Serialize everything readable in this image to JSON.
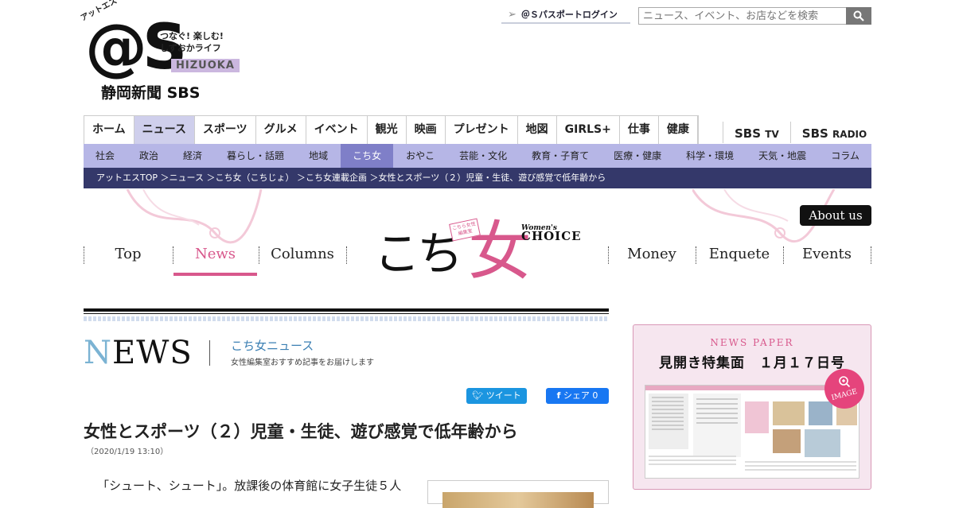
{
  "logo": {
    "kana": "アットエス",
    "mark": "@S",
    "tagline1": "つなぐ! 楽しむ!",
    "tagline2": "しずおかライフ",
    "shizuoka": "HIZUOKA",
    "publisher": "静岡新聞 SBS"
  },
  "header": {
    "passport_login": "＠Ｓパスポートログイン",
    "search_placeholder": "ニュース、イベント、お店などを検索"
  },
  "main_nav": [
    {
      "label": "ホーム"
    },
    {
      "label": "ニュース",
      "active": true
    },
    {
      "label": "スポーツ"
    },
    {
      "label": "グルメ"
    },
    {
      "label": "イベント"
    },
    {
      "label": "観光"
    },
    {
      "label": "映画"
    },
    {
      "label": "プレゼント"
    },
    {
      "label": "地図"
    },
    {
      "label": "GIRLS+"
    },
    {
      "label": "仕事"
    },
    {
      "label": "健康"
    }
  ],
  "sbs_nav": [
    {
      "main": "SBS",
      "sub": "TV"
    },
    {
      "main": "SBS",
      "sub": "RADIO"
    }
  ],
  "sub_nav": [
    {
      "label": "社会"
    },
    {
      "label": "政治"
    },
    {
      "label": "経済"
    },
    {
      "label": "暮らし・話題"
    },
    {
      "label": "地域"
    },
    {
      "label": "こち女",
      "active": true
    },
    {
      "label": "おやこ"
    },
    {
      "label": "芸能・文化"
    },
    {
      "label": "教育・子育て"
    },
    {
      "label": "医療・健康"
    },
    {
      "label": "科学・環境"
    },
    {
      "label": "天気・地震"
    },
    {
      "label": "コラム"
    }
  ],
  "breadcrumb": "アットエスTOP ＞ニュース ＞こち女（こちじょ） ＞こち女連載企画 ＞女性とスポーツ（２）児童・生徒、遊び感覚で低年齢から",
  "section": {
    "about": "About us",
    "nav": {
      "top": "Top",
      "news": "News",
      "columns": "Columns",
      "money": "Money",
      "enquete": "Enquete",
      "events": "Events"
    },
    "logo_ko": "こち",
    "logo_onna": "女",
    "logo_badge": "こちら女性編集室",
    "logo_womens": "Women's",
    "logo_choice": "CHOICE"
  },
  "news_header": {
    "n": "N",
    "ews": "EWS",
    "subtitle": "こち女ニュース",
    "description": "女性編集室おすすめ記事をお届けします"
  },
  "social": {
    "tweet": "ツイート",
    "share": "シェア 0"
  },
  "article": {
    "title": "女性とスポーツ（２）児童・生徒、遊び感覚で低年齢から",
    "date": "（2020/1/19 13:10）",
    "body_first_line": "「シュート、シュート」。放課後の体育館に女子生徒５人"
  },
  "newspaper": {
    "label": "NEWS PAPER",
    "title": "見開き特集面　１月１７日号",
    "image_button": "IMAGE"
  },
  "colors": {
    "subnav_bg": "#b6b6e6",
    "subnav_active": "#7f7fc8",
    "breadcrumb_bg": "#34386a",
    "accent_pink": "#d8588c",
    "tweet_blue": "#1b95e0",
    "facebook_blue": "#1877f2"
  }
}
